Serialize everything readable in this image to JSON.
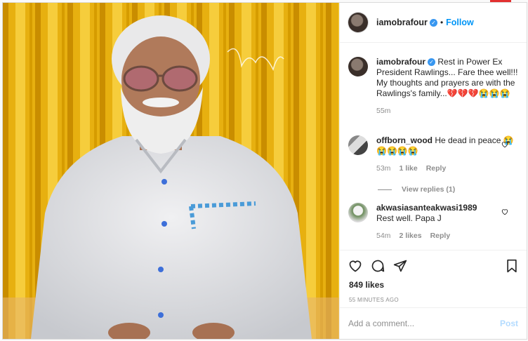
{
  "post": {
    "username": "iamobrafour",
    "follow_label": "Follow",
    "separator": "•"
  },
  "caption": {
    "username": "iamobrafour",
    "text": "Rest in Power Ex President Rawlings... Fare thee well!!!\nMy thoughts and prayers are with the Rawlings's family...💔💔💔😭😭😭",
    "time": "55m"
  },
  "comments": [
    {
      "username": "offborn_wood",
      "text": "He dead in peace 😭😭😭😭😭",
      "time": "53m",
      "likes": "1 like",
      "reply": "Reply"
    },
    {
      "username": "akwasiasanteakwasi1989",
      "text": "Rest well. Papa J",
      "time": "54m",
      "likes": "2 likes",
      "reply": "Reply"
    }
  ],
  "view_replies": "View replies (1)",
  "likes_count": "849 likes",
  "posted_ago": "55 MINUTES AGO",
  "add_comment_placeholder": "Add a comment...",
  "post_button": "Post",
  "icons": [
    "heart-icon",
    "comment-icon",
    "share-icon",
    "bookmark-icon",
    "verified-icon"
  ],
  "colors": {
    "accent": "#0095f6",
    "post_disabled": "#b3dbff",
    "verified": "#3897f0"
  }
}
